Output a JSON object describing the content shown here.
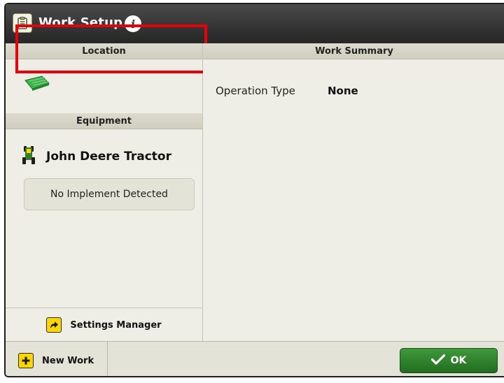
{
  "window": {
    "title": "Work Setup",
    "icons": {
      "app": "work-setup-clipboard-icon",
      "info": "info-icon"
    }
  },
  "left_panel": {
    "location": {
      "header": "Location",
      "value": "---",
      "icon": "field-icon",
      "highlight_color": "#e8000b"
    },
    "equipment": {
      "header": "Equipment",
      "tractor_name": "John Deere Tractor",
      "tractor_icon": "tractor-icon",
      "implement_status": "No Implement Detected"
    },
    "settings_manager": {
      "label": "Settings Manager",
      "icon": "arrow-forward-icon"
    }
  },
  "right_panel": {
    "header": "Work Summary",
    "operation_type": {
      "label": "Operation Type",
      "value": "None"
    }
  },
  "footer": {
    "new_work_label": "New Work",
    "new_work_icon": "plus-icon",
    "ok_label": "OK",
    "ok_icon": "checkmark-icon"
  },
  "colors": {
    "titlebar": "#333333",
    "panel_background": "#efeee6",
    "accent_yellow": "#ffd600",
    "ok_green": "#2e8b2a",
    "jd_green": "#367c2b"
  }
}
